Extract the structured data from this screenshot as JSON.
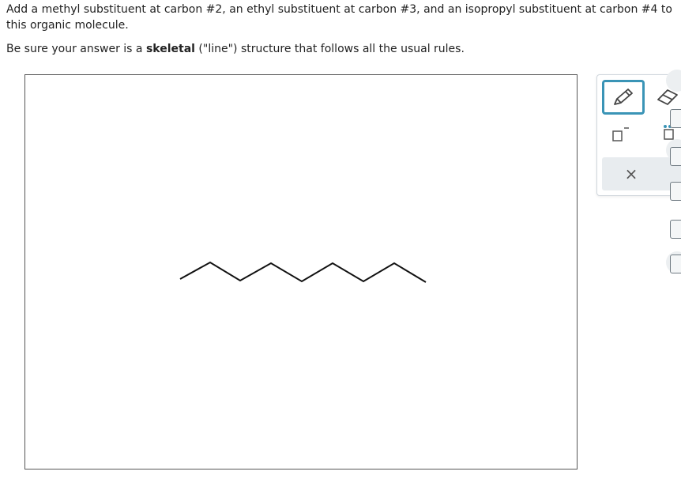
{
  "question": {
    "line1": "Add a methyl substituent at carbon #2, an ethyl substituent at carbon #3, and an isopropyl substituent at carbon #4 to",
    "line2": "this organic molecule."
  },
  "instructions": {
    "prefix": "Be sure your answer is a ",
    "bold": "skeletal",
    "suffix": " (\"line\") structure that follows all the usual rules."
  },
  "toolbar": {
    "pencil_icon": "pencil-icon",
    "eraser_icon": "eraser-icon",
    "charge_icon": "charge-box-icon",
    "lone_pair_icon": "lone-pair-box-icon",
    "clear_label": "×",
    "accent_color": "#3a94b6"
  },
  "molecule": {
    "type": "skeletal-chain",
    "carbon_count": 9
  }
}
